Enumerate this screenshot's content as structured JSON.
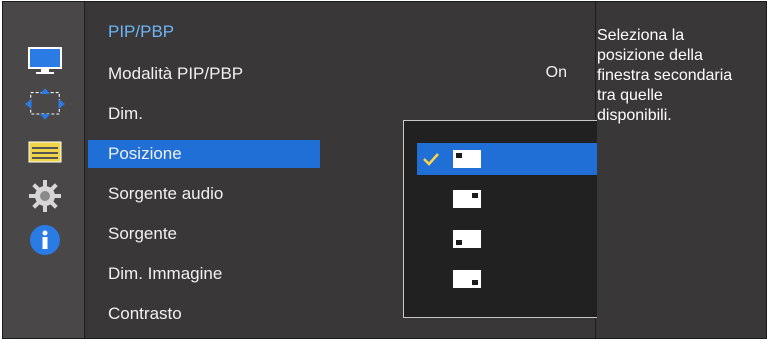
{
  "sidebar": {
    "icons": [
      {
        "name": "monitor-icon"
      },
      {
        "name": "pip-arrows-icon"
      },
      {
        "name": "slider-icon"
      },
      {
        "name": "gear-icon"
      },
      {
        "name": "info-icon"
      }
    ]
  },
  "menu": {
    "title": "PIP/PBP",
    "items": [
      {
        "label": "Modalità PIP/PBP",
        "value": "On"
      },
      {
        "label": "Dim."
      },
      {
        "label": "Posizione"
      },
      {
        "label": "Sorgente audio"
      },
      {
        "label": "Sorgente"
      },
      {
        "label": "Dim. Immagine"
      },
      {
        "label": "Contrasto"
      }
    ]
  },
  "popup": {
    "options": [
      {
        "name": "top-left"
      },
      {
        "name": "top-right"
      },
      {
        "name": "bottom-left"
      },
      {
        "name": "bottom-right"
      }
    ]
  },
  "help": {
    "lines": [
      "Seleziona la",
      "posizione della",
      "finestra secondaria",
      "tra quelle",
      "disponibili."
    ]
  },
  "colors": {
    "accent": "#1f6fd6",
    "title": "#6db5f5",
    "background": "#393637"
  }
}
